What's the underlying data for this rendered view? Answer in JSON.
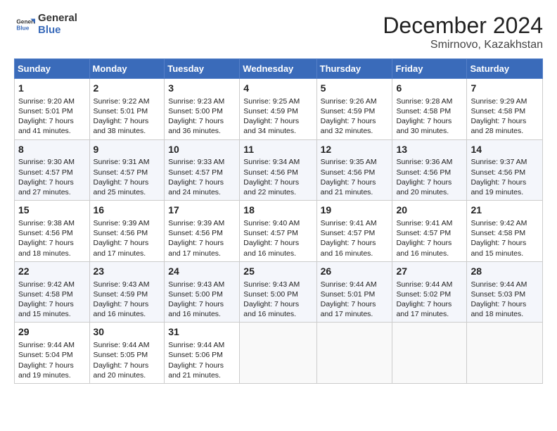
{
  "header": {
    "logo_line1": "General",
    "logo_line2": "Blue",
    "month_title": "December 2024",
    "location": "Smirnovo, Kazakhstan"
  },
  "weekdays": [
    "Sunday",
    "Monday",
    "Tuesday",
    "Wednesday",
    "Thursday",
    "Friday",
    "Saturday"
  ],
  "weeks": [
    [
      {
        "day": "1",
        "sunrise": "9:20 AM",
        "sunset": "5:01 PM",
        "daylight": "7 hours and 41 minutes."
      },
      {
        "day": "2",
        "sunrise": "9:22 AM",
        "sunset": "5:01 PM",
        "daylight": "7 hours and 38 minutes."
      },
      {
        "day": "3",
        "sunrise": "9:23 AM",
        "sunset": "5:00 PM",
        "daylight": "7 hours and 36 minutes."
      },
      {
        "day": "4",
        "sunrise": "9:25 AM",
        "sunset": "4:59 PM",
        "daylight": "7 hours and 34 minutes."
      },
      {
        "day": "5",
        "sunrise": "9:26 AM",
        "sunset": "4:59 PM",
        "daylight": "7 hours and 32 minutes."
      },
      {
        "day": "6",
        "sunrise": "9:28 AM",
        "sunset": "4:58 PM",
        "daylight": "7 hours and 30 minutes."
      },
      {
        "day": "7",
        "sunrise": "9:29 AM",
        "sunset": "4:58 PM",
        "daylight": "7 hours and 28 minutes."
      }
    ],
    [
      {
        "day": "8",
        "sunrise": "9:30 AM",
        "sunset": "4:57 PM",
        "daylight": "7 hours and 27 minutes."
      },
      {
        "day": "9",
        "sunrise": "9:31 AM",
        "sunset": "4:57 PM",
        "daylight": "7 hours and 25 minutes."
      },
      {
        "day": "10",
        "sunrise": "9:33 AM",
        "sunset": "4:57 PM",
        "daylight": "7 hours and 24 minutes."
      },
      {
        "day": "11",
        "sunrise": "9:34 AM",
        "sunset": "4:56 PM",
        "daylight": "7 hours and 22 minutes."
      },
      {
        "day": "12",
        "sunrise": "9:35 AM",
        "sunset": "4:56 PM",
        "daylight": "7 hours and 21 minutes."
      },
      {
        "day": "13",
        "sunrise": "9:36 AM",
        "sunset": "4:56 PM",
        "daylight": "7 hours and 20 minutes."
      },
      {
        "day": "14",
        "sunrise": "9:37 AM",
        "sunset": "4:56 PM",
        "daylight": "7 hours and 19 minutes."
      }
    ],
    [
      {
        "day": "15",
        "sunrise": "9:38 AM",
        "sunset": "4:56 PM",
        "daylight": "7 hours and 18 minutes."
      },
      {
        "day": "16",
        "sunrise": "9:39 AM",
        "sunset": "4:56 PM",
        "daylight": "7 hours and 17 minutes."
      },
      {
        "day": "17",
        "sunrise": "9:39 AM",
        "sunset": "4:56 PM",
        "daylight": "7 hours and 17 minutes."
      },
      {
        "day": "18",
        "sunrise": "9:40 AM",
        "sunset": "4:57 PM",
        "daylight": "7 hours and 16 minutes."
      },
      {
        "day": "19",
        "sunrise": "9:41 AM",
        "sunset": "4:57 PM",
        "daylight": "7 hours and 16 minutes."
      },
      {
        "day": "20",
        "sunrise": "9:41 AM",
        "sunset": "4:57 PM",
        "daylight": "7 hours and 16 minutes."
      },
      {
        "day": "21",
        "sunrise": "9:42 AM",
        "sunset": "4:58 PM",
        "daylight": "7 hours and 15 minutes."
      }
    ],
    [
      {
        "day": "22",
        "sunrise": "9:42 AM",
        "sunset": "4:58 PM",
        "daylight": "7 hours and 15 minutes."
      },
      {
        "day": "23",
        "sunrise": "9:43 AM",
        "sunset": "4:59 PM",
        "daylight": "7 hours and 16 minutes."
      },
      {
        "day": "24",
        "sunrise": "9:43 AM",
        "sunset": "5:00 PM",
        "daylight": "7 hours and 16 minutes."
      },
      {
        "day": "25",
        "sunrise": "9:43 AM",
        "sunset": "5:00 PM",
        "daylight": "7 hours and 16 minutes."
      },
      {
        "day": "26",
        "sunrise": "9:44 AM",
        "sunset": "5:01 PM",
        "daylight": "7 hours and 17 minutes."
      },
      {
        "day": "27",
        "sunrise": "9:44 AM",
        "sunset": "5:02 PM",
        "daylight": "7 hours and 17 minutes."
      },
      {
        "day": "28",
        "sunrise": "9:44 AM",
        "sunset": "5:03 PM",
        "daylight": "7 hours and 18 minutes."
      }
    ],
    [
      {
        "day": "29",
        "sunrise": "9:44 AM",
        "sunset": "5:04 PM",
        "daylight": "7 hours and 19 minutes."
      },
      {
        "day": "30",
        "sunrise": "9:44 AM",
        "sunset": "5:05 PM",
        "daylight": "7 hours and 20 minutes."
      },
      {
        "day": "31",
        "sunrise": "9:44 AM",
        "sunset": "5:06 PM",
        "daylight": "7 hours and 21 minutes."
      },
      null,
      null,
      null,
      null
    ]
  ],
  "labels": {
    "sunrise": "Sunrise:",
    "sunset": "Sunset:",
    "daylight": "Daylight:"
  }
}
